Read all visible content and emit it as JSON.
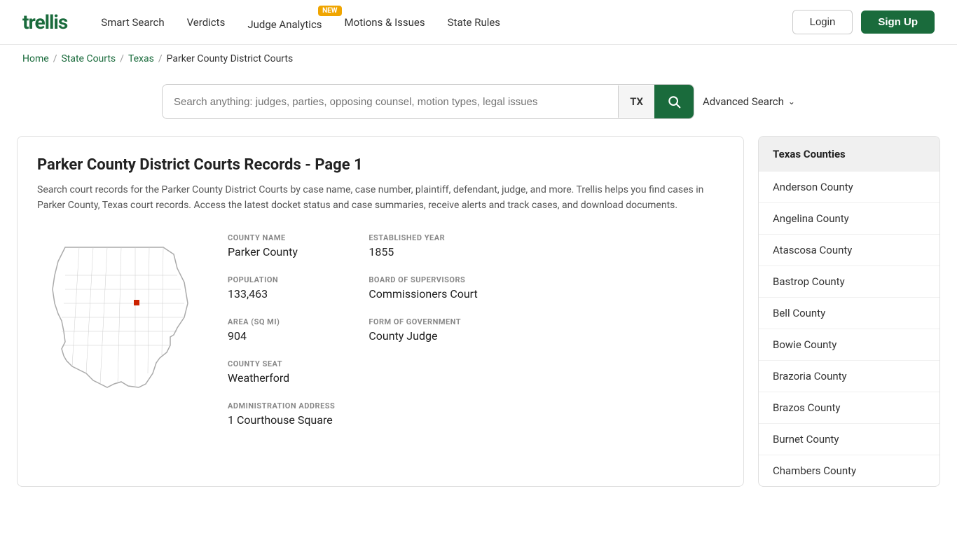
{
  "header": {
    "logo": "trellis",
    "nav": [
      {
        "label": "Smart Search",
        "badge": null
      },
      {
        "label": "Verdicts",
        "badge": null
      },
      {
        "label": "Judge Analytics",
        "badge": "NEW"
      },
      {
        "label": "Motions & Issues",
        "badge": null
      },
      {
        "label": "State Rules",
        "badge": null
      }
    ],
    "login_label": "Login",
    "signup_label": "Sign Up"
  },
  "breadcrumb": {
    "home": "Home",
    "state_courts": "State Courts",
    "state": "Texas",
    "current": "Parker County District Courts"
  },
  "search": {
    "placeholder": "Search anything: judges, parties, opposing counsel, motion types, legal issues",
    "state": "TX",
    "advanced_label": "Advanced Search"
  },
  "content": {
    "title": "Parker County District Courts Records - Page 1",
    "description": "Search court records for the Parker County District Courts by case name, case number, plaintiff, defendant, judge, and more. Trellis helps you find cases in Parker County, Texas court records. Access the latest docket status and case summaries, receive alerts and track cases, and download documents.",
    "county": {
      "name_label": "COUNTY NAME",
      "name_value": "Parker County",
      "established_label": "ESTABLISHED YEAR",
      "established_value": "1855",
      "population_label": "POPULATION",
      "population_value": "133,463",
      "board_label": "BOARD OF SUPERVISORS",
      "board_value": "Commissioners Court",
      "area_label": "AREA (SQ MI)",
      "area_value": "904",
      "form_label": "FORM OF GOVERNMENT",
      "form_value": "County Judge",
      "seat_label": "COUNTY SEAT",
      "seat_value": "Weatherford",
      "address_label": "ADMINISTRATION ADDRESS",
      "address_value": "1 Courthouse Square"
    }
  },
  "sidebar": {
    "header": "Texas Counties",
    "counties": [
      "Anderson County",
      "Angelina County",
      "Atascosa County",
      "Bastrop County",
      "Bell County",
      "Bowie County",
      "Brazoria County",
      "Brazos County",
      "Burnet County",
      "Chambers County"
    ]
  }
}
